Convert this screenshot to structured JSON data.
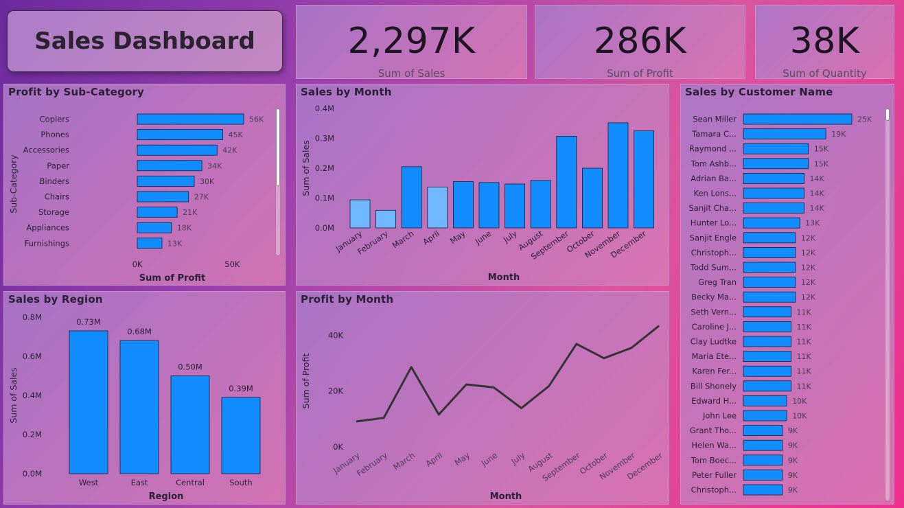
{
  "dashboard": {
    "title": "Sales Dashboard"
  },
  "kpis": [
    {
      "value": "2,297K",
      "label": "Sum of Sales"
    },
    {
      "value": "286K",
      "label": "Sum of Profit"
    },
    {
      "value": "38K",
      "label": "Sum of Quantity"
    }
  ],
  "colors": {
    "bar": "#118dff",
    "bar_dim": "#6fb7ff",
    "line": "#333333",
    "label": "#4a3a55"
  },
  "chart_data": [
    {
      "id": "profit_subcat",
      "type": "bar",
      "orientation": "horizontal",
      "title": "Profit by Sub-Category",
      "xlabel": "Sum of Profit",
      "ylabel": "Sub-Category",
      "categories": [
        "Copiers",
        "Phones",
        "Accessories",
        "Paper",
        "Binders",
        "Chairs",
        "Storage",
        "Appliances",
        "Furnishings"
      ],
      "values": [
        56,
        45,
        42,
        34,
        30,
        27,
        21,
        18,
        13
      ],
      "data_labels": [
        "56K",
        "45K",
        "42K",
        "34K",
        "30K",
        "27K",
        "21K",
        "18K",
        "13K"
      ],
      "x_ticks": [
        0,
        50
      ],
      "x_tick_labels": [
        "0K",
        "50K"
      ],
      "xlim": [
        0,
        60
      ],
      "unit": "K"
    },
    {
      "id": "sales_month",
      "type": "bar",
      "title": "Sales by Month",
      "xlabel": "Month",
      "ylabel": "Sum of Sales",
      "categories": [
        "January",
        "February",
        "March",
        "April",
        "May",
        "June",
        "July",
        "August",
        "September",
        "October",
        "November",
        "December"
      ],
      "values": [
        0.094,
        0.059,
        0.205,
        0.137,
        0.155,
        0.152,
        0.147,
        0.159,
        0.307,
        0.2,
        0.352,
        0.325
      ],
      "highlight": [
        false,
        false,
        true,
        false,
        true,
        true,
        true,
        true,
        true,
        true,
        true,
        true
      ],
      "y_ticks": [
        0,
        0.1,
        0.2,
        0.3,
        0.4
      ],
      "y_tick_labels": [
        "0.0M",
        "0.1M",
        "0.2M",
        "0.3M",
        "0.4M"
      ],
      "ylim": [
        0,
        0.4
      ],
      "unit": "M"
    },
    {
      "id": "sales_customer",
      "type": "bar",
      "orientation": "horizontal",
      "title": "Sales by Customer Name",
      "categories": [
        "Sean Miller",
        "Tamara C...",
        "Raymond ...",
        "Tom Ashb...",
        "Adrian Ba...",
        "Ken Lons...",
        "Sanjit Cha...",
        "Hunter Lo...",
        "Sanjit Engle",
        "Christoph...",
        "Todd Sum...",
        "Greg Tran",
        "Becky Ma...",
        "Seth Vern...",
        "Caroline J...",
        "Clay Ludtke",
        "Maria Ete...",
        "Karen Fer...",
        "Bill Shonely",
        "Edward H...",
        "John Lee",
        "Grant Tho...",
        "Helen Wa...",
        "Tom Boec...",
        "Peter Fuller",
        "Christoph..."
      ],
      "values": [
        25,
        19,
        15,
        15,
        14,
        14,
        14,
        13,
        12,
        12,
        12,
        12,
        12,
        11,
        11,
        11,
        11,
        11,
        11,
        10,
        10,
        9,
        9,
        9,
        9,
        9
      ],
      "data_labels": [
        "25K",
        "19K",
        "15K",
        "15K",
        "14K",
        "14K",
        "14K",
        "13K",
        "12K",
        "12K",
        "12K",
        "12K",
        "12K",
        "11K",
        "11K",
        "11K",
        "11K",
        "11K",
        "11K",
        "10K",
        "10K",
        "9K",
        "9K",
        "9K",
        "9K",
        "9K"
      ],
      "xlim": [
        0,
        25
      ],
      "unit": "K"
    },
    {
      "id": "sales_region",
      "type": "bar",
      "title": "Sales by Region",
      "xlabel": "Region",
      "ylabel": "Sum of Sales",
      "categories": [
        "West",
        "East",
        "Central",
        "South"
      ],
      "values": [
        0.73,
        0.68,
        0.5,
        0.39
      ],
      "data_labels": [
        "0.73M",
        "0.68M",
        "0.50M",
        "0.39M"
      ],
      "y_ticks": [
        0,
        0.2,
        0.4,
        0.6,
        0.8
      ],
      "y_tick_labels": [
        "0.0M",
        "0.2M",
        "0.4M",
        "0.6M",
        "0.8M"
      ],
      "ylim": [
        0,
        0.8
      ],
      "unit": "M"
    },
    {
      "id": "profit_month",
      "type": "line",
      "title": "Profit by Month",
      "xlabel": "Month",
      "ylabel": "Sum of Profit",
      "categories": [
        "January",
        "February",
        "March",
        "April",
        "May",
        "June",
        "July",
        "August",
        "September",
        "October",
        "November",
        "December"
      ],
      "values": [
        9.1,
        10.4,
        28.6,
        11.6,
        22.4,
        21.3,
        13.9,
        21.8,
        36.9,
        31.8,
        35.5,
        43.4
      ],
      "y_ticks": [
        0,
        20,
        40
      ],
      "y_tick_labels": [
        "0K",
        "20K",
        "40K"
      ],
      "ylim": [
        0,
        47
      ],
      "unit": "K"
    }
  ]
}
